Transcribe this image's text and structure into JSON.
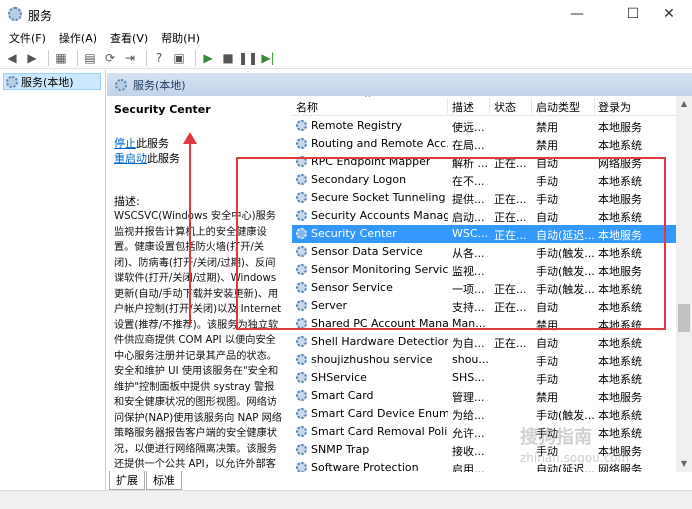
{
  "window": {
    "title": "服务",
    "minimize": "—",
    "maximize": "☐",
    "close": "✕"
  },
  "menu": [
    "文件(F)",
    "操作(A)",
    "查看(V)",
    "帮助(H)"
  ],
  "tree": {
    "selected": "服务(本地)"
  },
  "header": {
    "title": "服务(本地)"
  },
  "details": {
    "service_name": "Security Center",
    "stop_link": "停止",
    "stop_suffix": "此服务",
    "restart_link": "重启动",
    "restart_suffix": "此服务",
    "desc_label": "描述:",
    "desc_body": "WSCSVC(Windows 安全中心)服务监视并报告计算机上的安全健康设置。健康设置包括防火墙(打开/关闭)、防病毒(打开/关闭/过期)、反间谍软件(打开/关闭/过期)、Windows 更新(自动/手动下载并安装更新)、用户帐户控制(打开/关闭)以及 Internet 设置(推荐/不推荐)。该服务为独立软件供应商提供 COM API 以便向安全中心服务注册并记录其产品的状态。安全和维护 UI 使用该服务在\"安全和维护\"控制面板中提供 systray 警报和安全健康状况的图形视图。网络访问保护(NAP)使用该服务向 NAP 网络策略服务器报告客户端的安全健康状况，以便进行网络隔离决策。该服务还提供一个公共 API，以允许外部客户以编程方式检索系统的聚合安全健康状况。"
  },
  "table": {
    "columns": [
      "名称",
      "描述",
      "状态",
      "启动类型",
      "登录为"
    ],
    "rows": [
      {
        "name": "Remote Registry",
        "desc": "使远...",
        "status": "",
        "start": "禁用",
        "logon": "本地服务"
      },
      {
        "name": "Routing and Remote Acc...",
        "desc": "在局...",
        "status": "",
        "start": "禁用",
        "logon": "本地系统"
      },
      {
        "name": "RPC Endpoint Mapper",
        "desc": "解析 ...",
        "status": "正在...",
        "start": "自动",
        "logon": "网络服务"
      },
      {
        "name": "Secondary Logon",
        "desc": "在不...",
        "status": "",
        "start": "手动",
        "logon": "本地系统"
      },
      {
        "name": "Secure Socket Tunneling ...",
        "desc": "提供...",
        "status": "正在...",
        "start": "手动",
        "logon": "本地服务"
      },
      {
        "name": "Security Accounts Manag...",
        "desc": "启动...",
        "status": "正在...",
        "start": "自动",
        "logon": "本地系统"
      },
      {
        "name": "Security Center",
        "desc": "WSC...",
        "status": "正在...",
        "start": "自动(延迟...",
        "logon": "本地服务"
      },
      {
        "name": "Sensor Data Service",
        "desc": "从各...",
        "status": "",
        "start": "手动(触发...",
        "logon": "本地系统"
      },
      {
        "name": "Sensor Monitoring Service",
        "desc": "监视...",
        "status": "",
        "start": "手动(触发...",
        "logon": "本地服务"
      },
      {
        "name": "Sensor Service",
        "desc": "一项...",
        "status": "正在...",
        "start": "手动(触发...",
        "logon": "本地系统"
      },
      {
        "name": "Server",
        "desc": "支持...",
        "status": "正在...",
        "start": "自动",
        "logon": "本地系统"
      },
      {
        "name": "Shared PC Account Mana...",
        "desc": "Man...",
        "status": "",
        "start": "禁用",
        "logon": "本地系统"
      },
      {
        "name": "Shell Hardware Detection",
        "desc": "为自...",
        "status": "正在...",
        "start": "自动",
        "logon": "本地系统"
      },
      {
        "name": "shoujizhushou service",
        "desc": "shou...",
        "status": "",
        "start": "手动",
        "logon": "本地系统"
      },
      {
        "name": "SHService",
        "desc": "SHS...",
        "status": "",
        "start": "手动",
        "logon": "本地系统"
      },
      {
        "name": "Smart Card",
        "desc": "管理...",
        "status": "",
        "start": "禁用",
        "logon": "本地服务"
      },
      {
        "name": "Smart Card Device Enum...",
        "desc": "为给...",
        "status": "",
        "start": "手动(触发...",
        "logon": "本地系统"
      },
      {
        "name": "Smart Card Removal Poli...",
        "desc": "允许...",
        "status": "",
        "start": "手动",
        "logon": "本地系统"
      },
      {
        "name": "SNMP Trap",
        "desc": "接收...",
        "status": "",
        "start": "手动",
        "logon": "本地服务"
      },
      {
        "name": "Software Protection",
        "desc": "启用...",
        "status": "",
        "start": "自动(延迟...",
        "logon": "网络服务"
      }
    ],
    "selected_index": 6
  },
  "tabs": [
    "扩展",
    "标准"
  ],
  "watermark": {
    "text": "搜狗指南",
    "sub": "zhinan.sogou.com"
  },
  "colors": {
    "selection": "#3399ff",
    "annotation": "#e0393e",
    "link": "#0066cc"
  }
}
